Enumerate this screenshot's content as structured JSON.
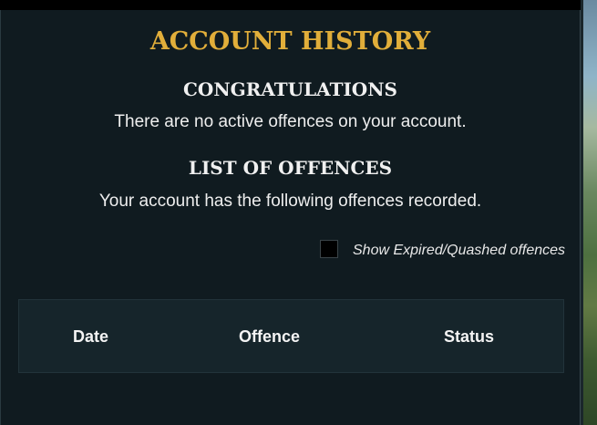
{
  "page": {
    "title": "ACCOUNT HISTORY",
    "congrats_heading": "CONGRATULATIONS",
    "congrats_text": "There are no active offences on your account.",
    "list_heading": "LIST OF OFFENCES",
    "list_text": "Your account has the following offences recorded."
  },
  "filter": {
    "label": "Show Expired/Quashed offences",
    "checked": false
  },
  "table": {
    "columns": [
      "Date",
      "Offence",
      "Status"
    ],
    "rows": []
  },
  "colors": {
    "title": "#e1ae3a",
    "background": "#101b20",
    "table_header_bg": "#16252b"
  }
}
